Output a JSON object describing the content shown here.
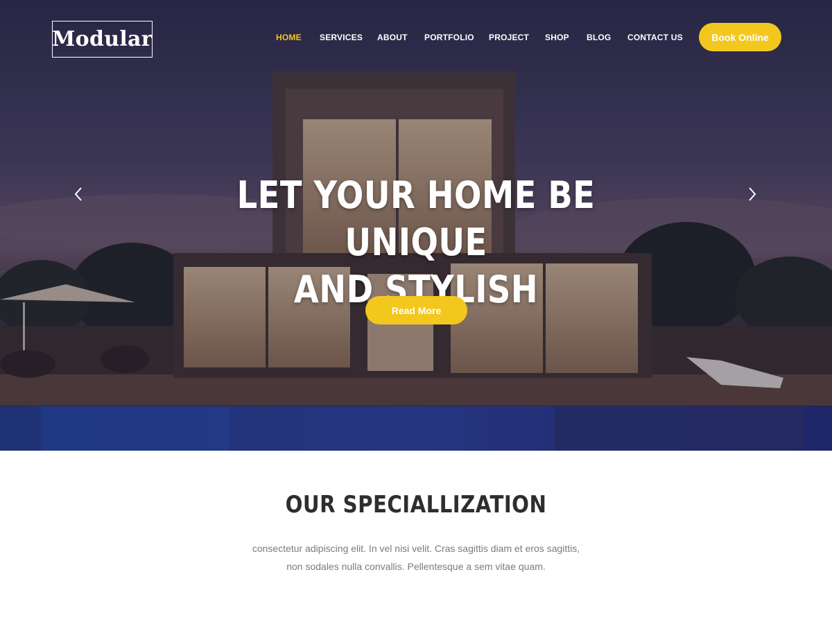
{
  "logo": {
    "text": "Modular"
  },
  "nav": {
    "items": [
      {
        "label": "HOME",
        "active": true
      },
      {
        "label": "SERVICES",
        "active": false
      },
      {
        "label": "ABOUT",
        "active": false
      },
      {
        "label": "PORTFOLIO",
        "active": false
      },
      {
        "label": "PROJECT",
        "active": false
      },
      {
        "label": "SHOP",
        "active": false
      },
      {
        "label": "BLOG",
        "active": false
      },
      {
        "label": "CONTACT US",
        "active": false
      }
    ],
    "cta_label": "Book Online"
  },
  "hero": {
    "title_line1": "LET YOUR HOME BE UNIQUE",
    "title_line2": "AND STYLISH",
    "button_label": "Read More",
    "prev_icon": "chevron-left-icon",
    "next_icon": "chevron-right-icon"
  },
  "specialization": {
    "title": "OUR SPECIALLIZATION",
    "text_line1": "consectetur adipiscing elit. In vel nisi velit. Cras sagittis diam et eros sagittis,",
    "text_line2": "non sodales nulla convallis. Pellentesque a sem vitae quam."
  },
  "colors": {
    "accent": "#f2c81f",
    "heading": "#2e2e2e",
    "body_text": "#7b7b7b",
    "nav_text": "#ffffff"
  }
}
